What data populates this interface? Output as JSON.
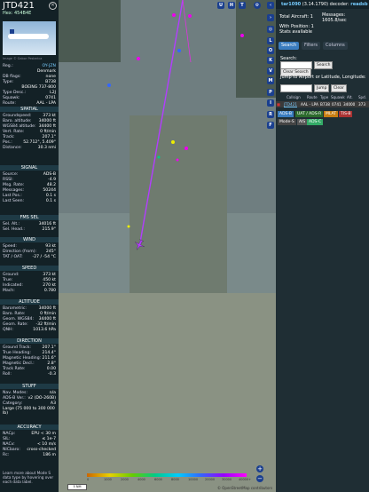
{
  "aircraft": {
    "callsign": "JTD421",
    "hex": "Hex:   454B4E",
    "photo_caption": "Image © Gabor Pesterica",
    "details": [
      {
        "k": "Reg.:",
        "v": "OY-JZN",
        "link": true
      },
      {
        "k": "",
        "v": "Denmark"
      },
      {
        "k": "DB flags:",
        "v": "none"
      },
      {
        "k": "Type:",
        "v": "B738"
      },
      {
        "k": "",
        "v": "BOEING 737-800"
      },
      {
        "k": "Type Desc.:",
        "v": "L2J"
      },
      {
        "k": "Squawk:",
        "v": "0741"
      },
      {
        "k": "Route:",
        "v": "AAL - LPA"
      }
    ]
  },
  "sections": {
    "spatial": "SPATIAL",
    "signal": "SIGNAL",
    "fms_sel": "FMS SEL",
    "wind": "WIND",
    "speed": "SPEED",
    "altitude": "ALTITUDE",
    "direction": "DIRECTION",
    "stuff": "STUFF",
    "accuracy": "ACCURACY"
  },
  "spatial": [
    {
      "k": "Groundspeed:",
      "v": "373 kt"
    },
    {
      "k": "Baro. altitude:",
      "v": "34000 ft"
    },
    {
      "k": "WGS84 altitude:",
      "v": "34400 ft"
    },
    {
      "k": "Vert. Rate:",
      "v": "0 ft/min"
    },
    {
      "k": "Track:",
      "v": "207.1°"
    },
    {
      "k": "Pos.:",
      "v": "52.712°, 5.409°"
    },
    {
      "k": "Distance:",
      "v": "30.3 nmi"
    }
  ],
  "signal": [
    {
      "k": "Source:",
      "v": "ADS-B"
    },
    {
      "k": "RSSI:",
      "v": "-4.9"
    },
    {
      "k": "Msg. Rate:",
      "v": "48.2"
    },
    {
      "k": "Messages:",
      "v": "50244"
    },
    {
      "k": "Last Pos.:",
      "v": "0.1 s"
    },
    {
      "k": "Last Seen:",
      "v": "0.1 s"
    }
  ],
  "fms": [
    {
      "k": "Sel. Alt.:",
      "v": "34016 ft"
    },
    {
      "k": "Sel. Head.:",
      "v": "215.9°"
    }
  ],
  "wind": [
    {
      "k": "Speed:",
      "v": "93 kt"
    },
    {
      "k": "Direction (from):",
      "v": "245°"
    },
    {
      "k": "TAT / OAT:",
      "v": "-27 / -54 °C"
    }
  ],
  "speed": [
    {
      "k": "Ground:",
      "v": "373 kt"
    },
    {
      "k": "True:",
      "v": "450 kt"
    },
    {
      "k": "Indicated:",
      "v": "270 kt"
    },
    {
      "k": "Mach:",
      "v": "0.780"
    }
  ],
  "altitude": [
    {
      "k": "Barometric:",
      "v": "34000 ft"
    },
    {
      "k": "Baro. Rate:",
      "v": "0 ft/min"
    },
    {
      "k": "Geom. WGS84:",
      "v": "34400 ft"
    },
    {
      "k": "Geom. Rate:",
      "v": "-32 ft/min"
    },
    {
      "k": "QNH:",
      "v": "1013.6 hPa"
    }
  ],
  "direction": [
    {
      "k": "Ground Track:",
      "v": "207.1°"
    },
    {
      "k": "True Heading:",
      "v": "214.4°"
    },
    {
      "k": "Magnetic Heading:",
      "v": "211.6°"
    },
    {
      "k": "Magnetic Decl.:",
      "v": "2.8°"
    },
    {
      "k": "Track Rate:",
      "v": "0.00"
    },
    {
      "k": "Roll:",
      "v": "-0.3"
    }
  ],
  "stuff": [
    {
      "k": "Nav. Modes:",
      "v": "n/a"
    },
    {
      "k": "ADS-B Ver.:",
      "v": "v2 (DO-260B)"
    },
    {
      "k": "Category:",
      "v": "A3"
    },
    {
      "k": "",
      "v": "Large (75 000 to 300 000 lb)"
    }
  ],
  "accuracy": [
    {
      "k": "NACp:",
      "v": "EPU < 30 m"
    },
    {
      "k": "SIL:",
      "v": "≤ 1e-7"
    },
    {
      "k": "NACv:",
      "v": "< 10 m/s"
    },
    {
      "k": "NICbaro:",
      "v": "cross-checked"
    },
    {
      "k": "Rc:",
      "v": "186 m"
    }
  ],
  "footer_note": "Learn more about Mode S data type by hovering over each data label.",
  "right": {
    "version_prefix": "tar1090",
    "version_suffix": " (3.14.1790) decoder: ",
    "decoder": "readsb",
    "total_aircraft": "Total Aircraft: 1",
    "with_position": "With Position: 1",
    "messages_label": "Messages:",
    "messages_rate": "1605.8/sec",
    "stats": "Stats available",
    "tabs": [
      "Search",
      "Filters",
      "Columns"
    ],
    "search_label": "Search:",
    "search_button": "Search",
    "clear_search": "Clear Search",
    "jump_label": "Jump to Airport or Latitude, Longitude:",
    "jump_button": "Jump",
    "clear_button": "Clear",
    "table_headers": [
      "Callsign",
      "Route",
      "Type",
      "Squawk",
      "Alt.",
      "Spd."
    ],
    "row": {
      "flag": "DK",
      "callsign": "JTD421",
      "route": "AAL - LPA",
      "type": "B738",
      "squawk": "0741",
      "alt": "34000",
      "spd": "373"
    },
    "filters": [
      "ADS-B",
      "UAT / ADS-R",
      "MLAT",
      "TIS-B",
      "Mode-S",
      "AIS",
      "ADS-C"
    ]
  },
  "map_buttons": {
    "u": "U",
    "h": "H",
    "t": "T",
    "l": "L",
    "o": "O",
    "k": "K",
    "v": "V",
    "m": "M",
    "p": "P",
    "i": "I",
    "r": "R",
    "f": "F"
  },
  "colors": {
    "accent": "#1a3f8f",
    "track": "#b33dff",
    "panel": "#132126"
  },
  "scale_label": "5 NM",
  "attribution": "© OpenStreetMap contributors",
  "colorbar_labels": [
    "0",
    "1000",
    "2000",
    "4000",
    "6000",
    "8000",
    "10000",
    "20000",
    "30000",
    "40000+"
  ]
}
